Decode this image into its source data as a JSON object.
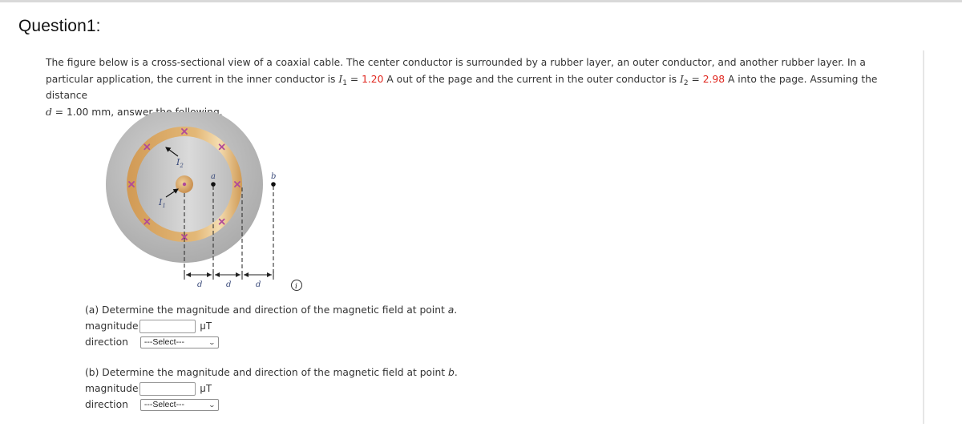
{
  "page": {
    "title": "Question1:"
  },
  "problem": {
    "text_1": "The figure below is a cross-sectional view of a coaxial cable. The center conductor is surrounded by a rubber layer, an outer conductor, and another rubber layer. In a particular application, the current in the inner conductor is ",
    "i1_symbol": "I",
    "i1_sub": "1",
    "eq": " = ",
    "i1_value": "1.20",
    "text_2": " A out of the page and the current in the outer conductor is ",
    "i2_symbol": "I",
    "i2_sub": "2",
    "i2_value": "2.98",
    "text_3": " A into the page. Assuming the distance ",
    "d_symbol": "d",
    "text_4": " = 1.00 mm, answer the following.",
    "value_color": "#e0271f"
  },
  "figure": {
    "label_i1": "I",
    "label_i1_sub": "1",
    "label_i2": "I",
    "label_i2_sub": "2",
    "label_a": "a",
    "label_b": "b",
    "label_d": "d",
    "info_icon": "i",
    "colors": {
      "outer_rubber": "#b9b9b9",
      "conductor": "#d9a866",
      "inner_rubber": "#c4c4c4",
      "current_mark": "#b04a9a",
      "label": "#3a4a7a"
    }
  },
  "parts": [
    {
      "prompt_text": "(a) Determine the magnitude and direction of the magnetic field at point ",
      "point": "a",
      "end": ".",
      "magnitude_label": "magnitude",
      "magnitude_value": "",
      "unit": "μT",
      "direction_label": "direction",
      "direction_selected": "---Select---"
    },
    {
      "prompt_text": "(b) Determine the magnitude and direction of the magnetic field at point ",
      "point": "b",
      "end": ".",
      "magnitude_label": "magnitude",
      "magnitude_value": "",
      "unit": "μT",
      "direction_label": "direction",
      "direction_selected": "---Select---"
    }
  ]
}
